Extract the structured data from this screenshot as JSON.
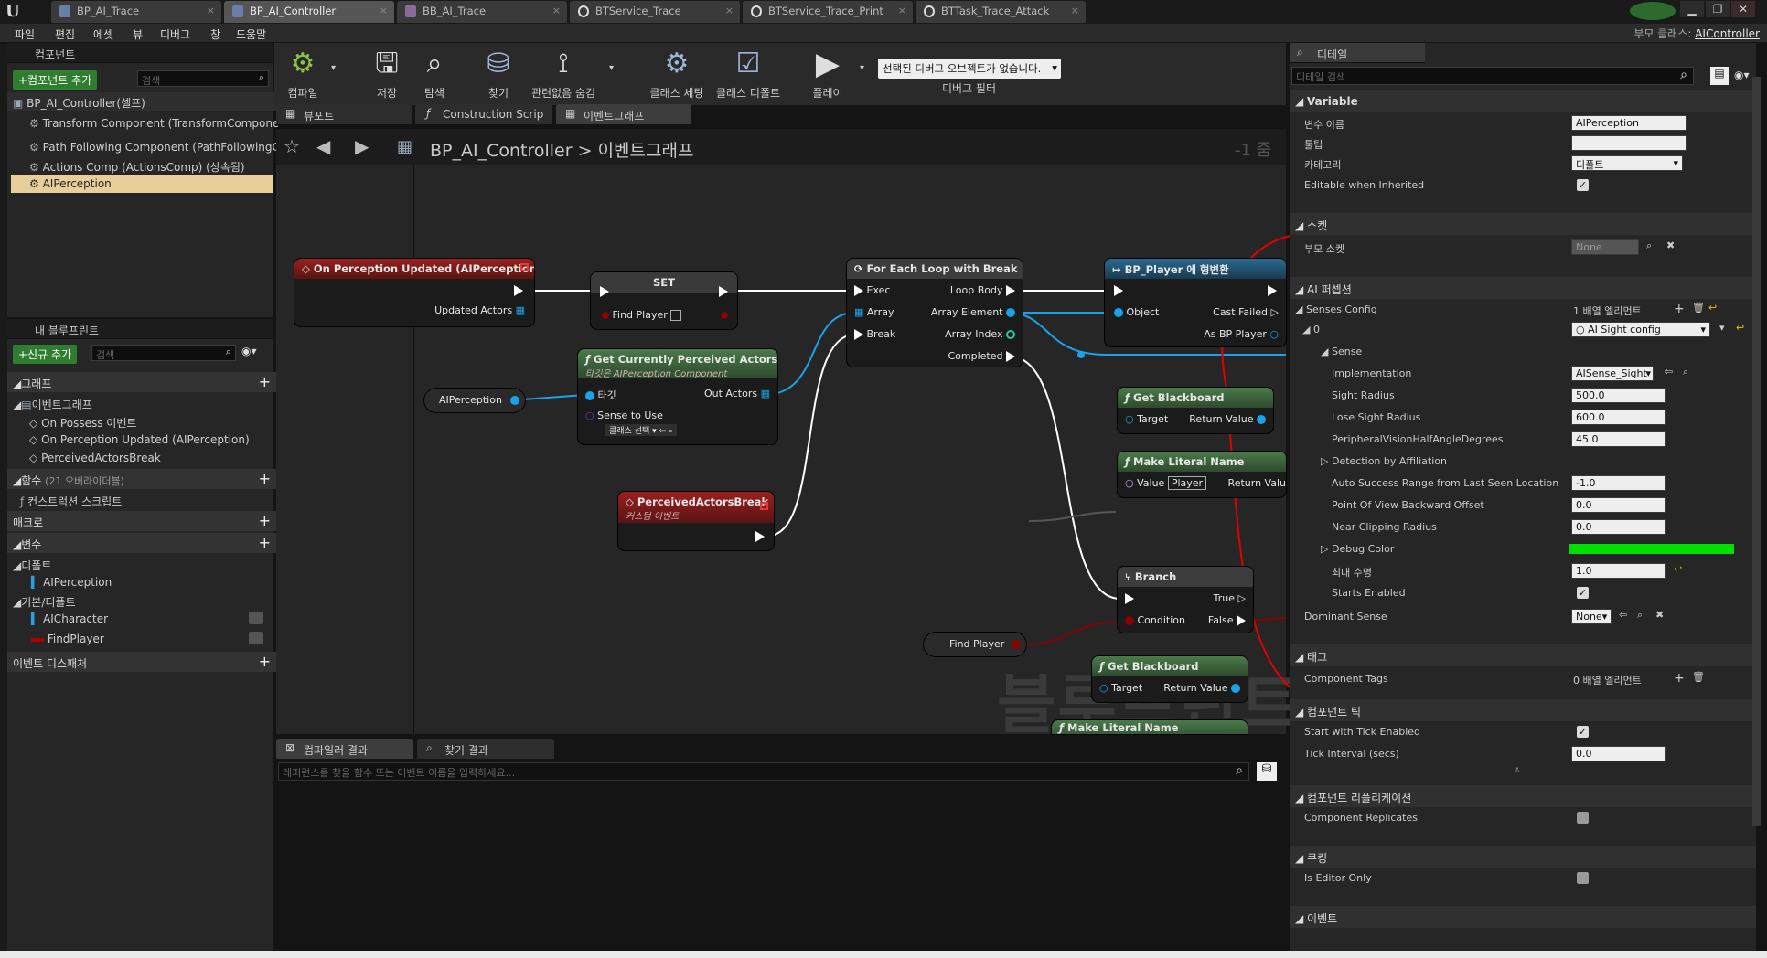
{
  "titlebar": {
    "tabs": [
      {
        "label": "BP_AI_Trace",
        "icon": "blueprint-icon"
      },
      {
        "label": "BP_AI_Controller",
        "icon": "blueprint-icon"
      },
      {
        "label": "BB_AI_Trace",
        "icon": "blackboard-icon"
      },
      {
        "label": "BTService_Trace",
        "icon": "bt-icon"
      },
      {
        "label": "BTService_Trace_Print",
        "icon": "bt-icon"
      },
      {
        "label": "BTTask_Trace_Attack",
        "icon": "bt-icon"
      }
    ]
  },
  "menubar": {
    "items": [
      "파일",
      "편집",
      "에셋",
      "뷰",
      "디버그",
      "창",
      "도움말"
    ],
    "parent_class_label": "부모 클래스:",
    "parent_class_value": "AIController"
  },
  "components_panel": {
    "title": "컴포넌트",
    "add_button": "+컴포넌트 추가",
    "search_placeholder": "검색",
    "root": "BP_AI_Controller(셀프)",
    "items": [
      "Transform Component (TransformComponent",
      "Path Following Component (PathFollowingC",
      "Actions Comp (ActionsComp) (상속됨)",
      "AIPerception"
    ]
  },
  "my_blueprint": {
    "title": "내 블루프린트",
    "add_button": "+신규 추가",
    "search_placeholder": "검색",
    "graph_cat": "그래프",
    "event_graph": "이벤트그래프",
    "events": [
      "On Possess 이벤트",
      "On Perception Updated (AIPerception)",
      "PerceivedActorsBreak"
    ],
    "functions_cat": "함수",
    "functions_note": "(21 오버라이더블)",
    "construction_script": "컨스트럭션 스크립트",
    "macros_cat": "매크로",
    "variables_cat": "변수",
    "default_cat": "디폴트",
    "default_vars": [
      "AIPerception"
    ],
    "basic_cat": "기본/디폴트",
    "basic_vars": [
      "AICharacter",
      "FindPlayer"
    ],
    "dispatcher_cat": "이벤트 디스패처"
  },
  "toolbar": {
    "buttons": [
      "컴파일",
      "저장",
      "탐색",
      "찾기",
      "관련없음 숨김",
      "클래스 세팅",
      "클래스 디폴트",
      "플레이"
    ],
    "debug_object": "선택된 디버그 오브젝트가 없습니다.",
    "debug_filter": "디버그 필터"
  },
  "editor_tabs": [
    "뷰포트",
    "Construction Scrip",
    "이벤트그래프"
  ],
  "graph": {
    "breadcrumb_bp": "BP_AI_Controller",
    "breadcrumb_sep": ">",
    "breadcrumb_graph": "이벤트그래프",
    "zoom": "-1 줌",
    "watermark": "블루프린트",
    "nodes": {
      "perception": {
        "title": "On Perception Updated (AIPerception)",
        "pin": "Updated Actors"
      },
      "set": {
        "title": "SET",
        "pin": "Find Player"
      },
      "get_perceived": {
        "title": "Get Currently Perceived Actors",
        "subtitle": "타깃은 AIPerception Component",
        "target": "타깃",
        "out": "Out Actors",
        "sense": "Sense to Use",
        "sense_value": "클래스 선택"
      },
      "aiperception_var": {
        "title": "AIPerception"
      },
      "perceived_break": {
        "title": "PerceivedActorsBreak",
        "subtitle": "커스텀 이벤트"
      },
      "foreach": {
        "title": "For Each Loop with Break",
        "exec": "Exec",
        "loop_body": "Loop Body",
        "array": "Array",
        "array_element": "Array Element",
        "break": "Break",
        "array_index": "Array Index",
        "completed": "Completed"
      },
      "cast": {
        "title": "BP_Player 에 형변환",
        "object": "Object",
        "cast_failed": "Cast Failed",
        "as_bp": "As BP Player"
      },
      "get_bb1": {
        "title": "Get Blackboard",
        "target": "Target",
        "ret": "Return Value"
      },
      "make_literal1": {
        "title": "Make Literal Name",
        "value": "Value",
        "value_input": "Player",
        "ret": "Return Valu"
      },
      "branch": {
        "title": "Branch",
        "true_pin": "True",
        "condition": "Condition",
        "false_pin": "False"
      },
      "find_player": {
        "title": "Find Player"
      },
      "get_bb2": {
        "title": "Get Blackboard",
        "target": "Target",
        "ret": "Return Value"
      },
      "make_literal2": {
        "title": "Make Literal Name"
      }
    }
  },
  "bottom_tabs": [
    "컴파일러 결과",
    "찾기 결과"
  ],
  "find_placeholder": "레퍼런스를 찾을 함수 또는 이벤트 이름을 입력하세요...",
  "details": {
    "title": "디테일",
    "search_placeholder": "디테일 검색",
    "variable_cat": "Variable",
    "var_name_label": "변수 이름",
    "var_name": "AIPerception",
    "tooltip_label": "툴팁",
    "tooltip": "",
    "category_label": "카테고리",
    "category": "디폴트",
    "editable_label": "Editable when Inherited",
    "socket_cat": "소켓",
    "parent_socket_label": "부모 소켓",
    "parent_socket": "None",
    "ai_cat": "AI 퍼셉션",
    "senses_label": "Senses Config",
    "senses_value": "1 배열 엘리먼트",
    "index0": "0",
    "index0_value": "AI Sight config",
    "sense_label": "Sense",
    "impl_label": "Implementation",
    "impl_value": "AISense_Sight",
    "sight_radius_label": "Sight Radius",
    "sight_radius": "500.0",
    "lose_sight_label": "Lose Sight Radius",
    "lose_sight": "600.0",
    "peripheral_label": "PeripheralVisionHalfAngleDegrees",
    "peripheral": "45.0",
    "affiliation_label": "Detection by Affiliation",
    "auto_success_label": "Auto Success Range from Last Seen Location",
    "auto_success": "-1.0",
    "pov_offset_label": "Point Of View Backward Offset",
    "pov_offset": "0.0",
    "near_clip_label": "Near Clipping Radius",
    "near_clip": "0.0",
    "debug_color_label": "Debug Color",
    "debug_color": "#00e000",
    "max_age_label": "최대 수명",
    "max_age": "1.0",
    "starts_enabled_label": "Starts Enabled",
    "dominant_label": "Dominant Sense",
    "dominant": "None",
    "tags_cat": "태그",
    "comp_tags_label": "Component Tags",
    "comp_tags": "0 배열 엘리먼트",
    "tick_cat": "컴포넌트 틱",
    "tick_enabled_label": "Start with Tick Enabled",
    "tick_interval_label": "Tick Interval (secs)",
    "tick_interval": "0.0",
    "replication_cat": "컴포넌트 리플리케이션",
    "replicates_label": "Component Replicates",
    "cooking_cat": "쿠킹",
    "editor_only_label": "Is Editor Only",
    "events_cat": "이벤트"
  },
  "colors": {
    "annotation": "#e00000",
    "event_header": "#8b1a1a",
    "function_header": "#2e5a2e",
    "cast_header": "#1d4a6a",
    "flow_header": "#4a4a4a",
    "wire_blue": "#1aa3e8"
  }
}
